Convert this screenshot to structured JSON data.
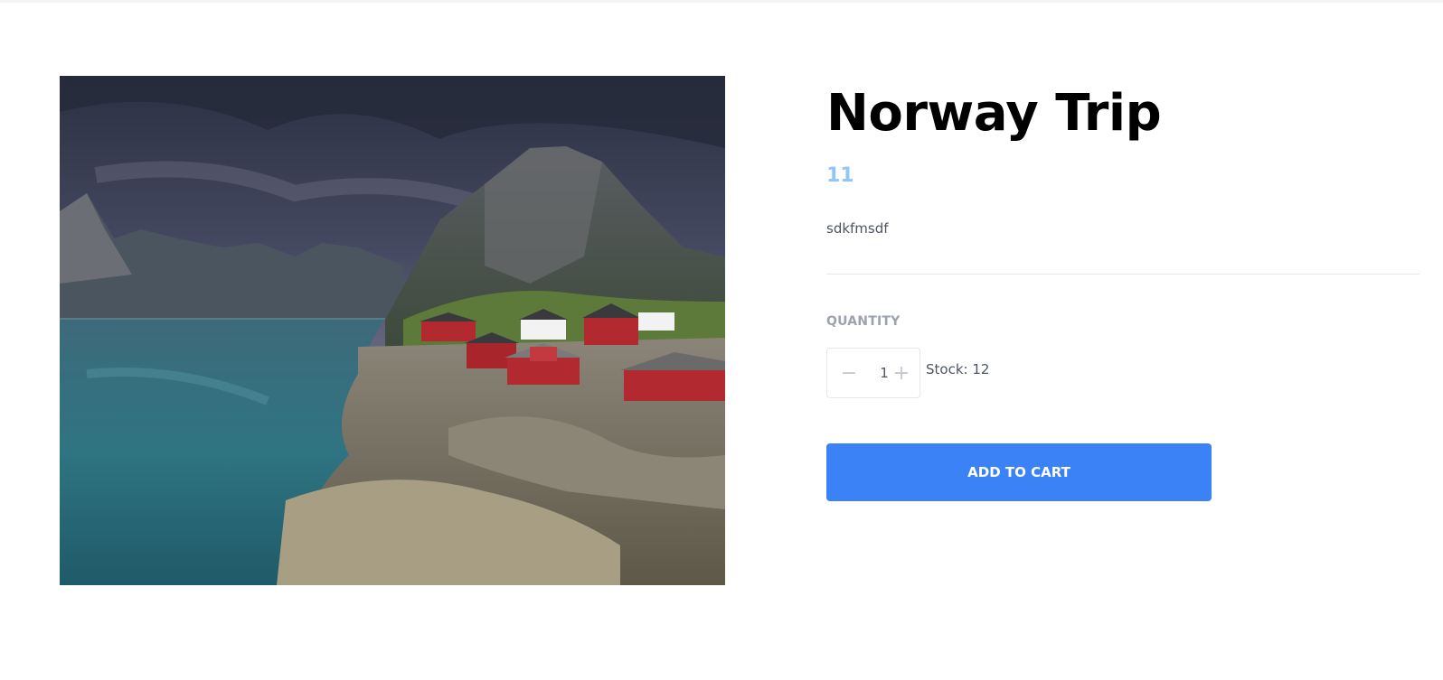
{
  "product": {
    "title": "Norway Trip",
    "price": "11",
    "description": "sdkfmsdf",
    "image_subject": "Norwegian fjord with red fishing cabins and mountains",
    "quantity_label": "QUANTITY",
    "quantity_value": "1",
    "stock_text": "Stock: 12",
    "add_to_cart_label": "ADD TO CART"
  },
  "icons": {
    "minus": "minus-icon",
    "plus": "plus-icon"
  },
  "colors": {
    "accent": "#3b82f6",
    "price": "#93c5fd",
    "muted_label": "#9ca3af"
  }
}
